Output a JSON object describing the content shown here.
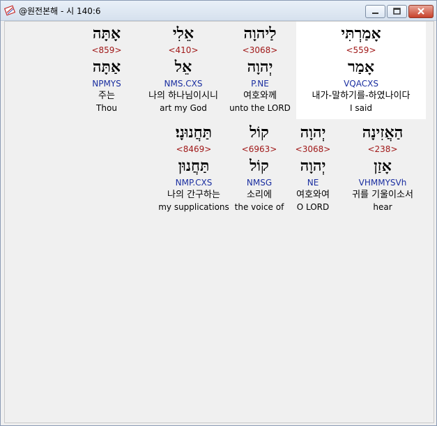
{
  "window": {
    "title": "@원전본해 - 시 140:6",
    "icon": "app-book-icon",
    "controls": [
      "minimize-icon",
      "maximize-icon",
      "close-icon"
    ]
  },
  "rows": [
    {
      "words": [
        {
          "heb": "אָמַרְתִּי",
          "strong": "<559>",
          "lex": "אָמַר",
          "morph": "VQACXS",
          "kor": "내가-말하기를-하였나이다",
          "eng": "I said",
          "highlight": true
        },
        {
          "heb": "לַיהוָה",
          "strong": "<3068>",
          "lex": "יְהוָה",
          "morph": "P.NE",
          "kor": "여호와께",
          "eng": "unto the LORD"
        },
        {
          "heb": "אֵלִי",
          "strong": "<410>",
          "lex": "אֵל",
          "morph": "NMS.CXS",
          "kor": "나의 하나님이시니",
          "eng": "art my God"
        },
        {
          "heb": "אָתָּה",
          "strong": "<859>",
          "lex": "אַתָּה",
          "morph": "NPMYS",
          "kor": "주는",
          "eng": "Thou"
        }
      ]
    },
    {
      "words": [
        {
          "heb": "הַאֲזִינָה",
          "strong": "<238>",
          "lex": "אָזַן",
          "morph": "VHMMYSVh",
          "kor": "귀를 기울이소서",
          "eng": "hear"
        },
        {
          "heb": "יְהוָה",
          "strong": "<3068>",
          "lex": "יְהוָה",
          "morph": "NE",
          "kor": "여호와여",
          "eng": "O LORD"
        },
        {
          "heb": "קוֹל",
          "strong": "<6963>",
          "lex": "קוֹל",
          "morph": "NMSG",
          "kor": "소리에",
          "eng": "the voice of"
        },
        {
          "heb": "תַּחֲנוּנָי׃",
          "strong": "<8469>",
          "lex": "תַּחֲנוּן",
          "morph": "NMP.CXS",
          "kor": "나의 간구하는",
          "eng": "my supplications"
        }
      ]
    }
  ]
}
